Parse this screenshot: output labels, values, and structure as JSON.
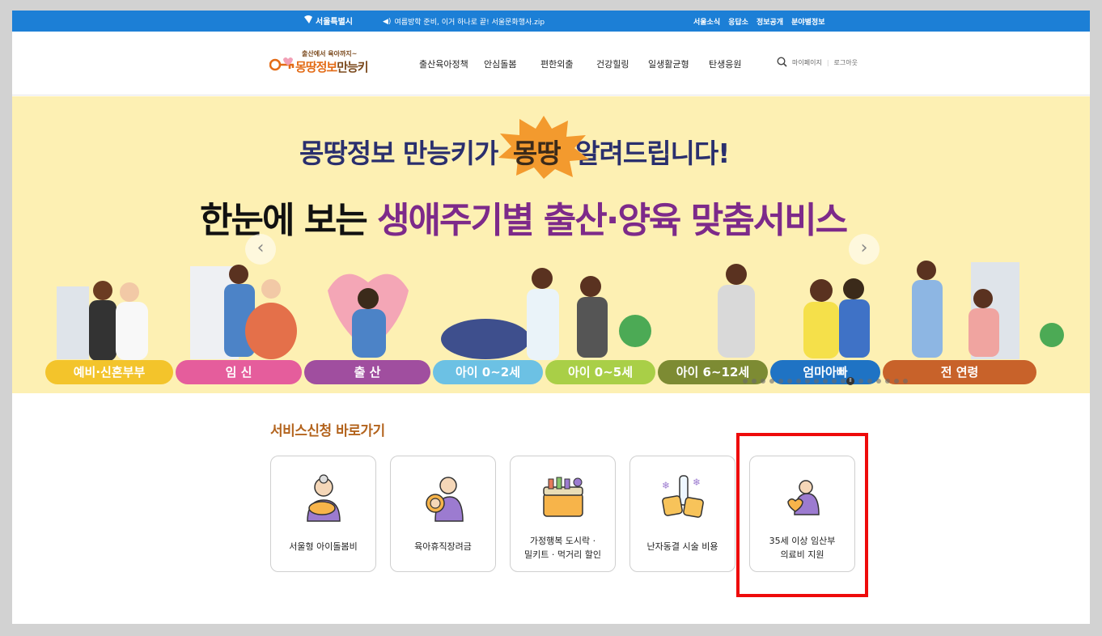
{
  "topbar": {
    "seoul_label": "서울특별시",
    "notice": "여름방학 준비, 이거 하나로 끝! 서울문화행사.zip",
    "links": [
      "서울소식",
      "응답소",
      "정보공개",
      "분야별정보"
    ]
  },
  "header": {
    "logo_small": "출산에서 육아까지~",
    "logo_main_a": "몽땅정보",
    "logo_main_b": "만능키",
    "nav": [
      "출산육아정책",
      "안심돌봄",
      "편한외출",
      "건강힐링",
      "일생활균형",
      "탄생응원"
    ],
    "util": [
      "마이페이지",
      "로그아웃"
    ]
  },
  "banner": {
    "line1_a": "몽땅정보 만능키가",
    "line1_burst": "몽땅",
    "line1_b": "알려드립니다!",
    "line2_a": "한눈에 보는",
    "line2_b": "생애주기별 출산·양육 맞춤서비스",
    "prev": "‹",
    "next": "›",
    "stages": [
      "예비·신혼부부",
      "임 신",
      "출 산",
      "아이 0~2세",
      "아이 0~5세",
      "아이 6~12세",
      "엄마아빠",
      "전 연령"
    ],
    "stage_colors": [
      "#f3c42b",
      "#e55d9c",
      "#a04e9f",
      "#6cc1e4",
      "#a9cf47",
      "#7d8b33",
      "#1f73c4",
      "#c8622a"
    ],
    "pause": "ll"
  },
  "services": {
    "title": "서비스신청 바로가기",
    "cards": [
      {
        "label": "서울형 아이돌봄비",
        "icon": "grandma-baby-icon"
      },
      {
        "label": "육아휴직장려금",
        "icon": "parent-child-icon"
      },
      {
        "label_1": "가정행복 도시락 ·",
        "label_2": "밀키트 · 먹거리 할인",
        "icon": "lunchbox-icon"
      },
      {
        "label": "난자동결 시술 비용",
        "icon": "test-tube-icon"
      },
      {
        "label_1": "35세 이상 임산부",
        "label_2": "의료비 지원",
        "icon": "pregnant-heart-icon"
      }
    ]
  }
}
